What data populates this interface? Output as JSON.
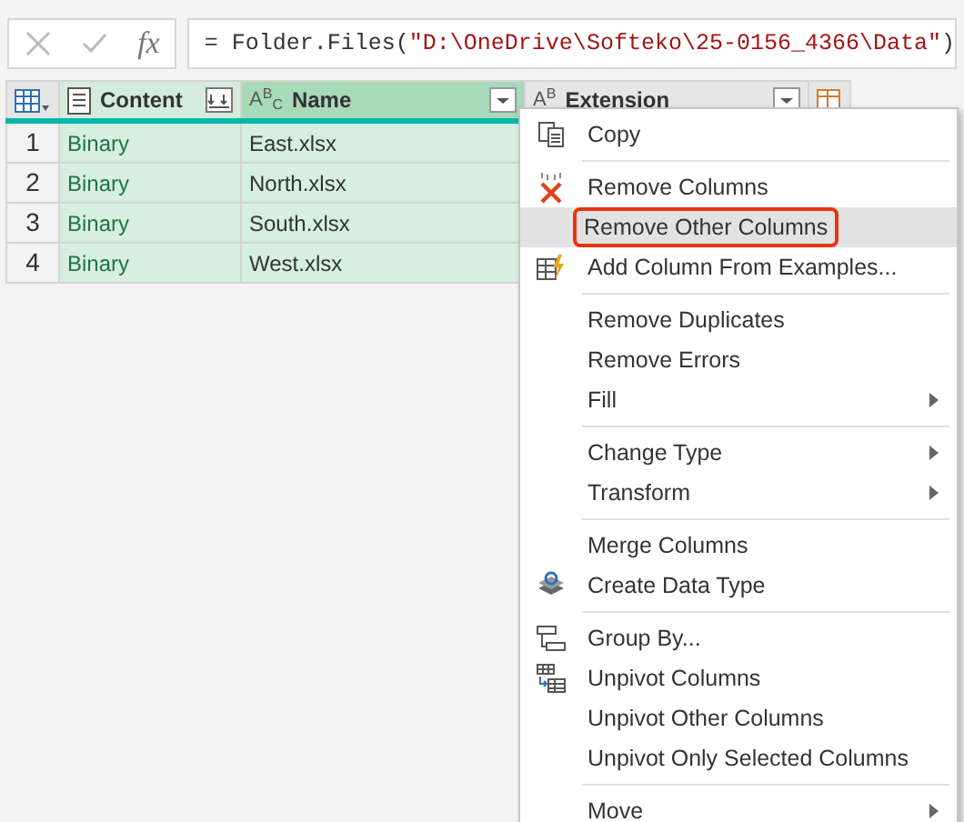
{
  "formula_bar": {
    "fx": "fx",
    "formula": "= Folder.Files(\"D:\\OneDrive\\Softeko\\25-0156_4366\\Data\")"
  },
  "table": {
    "columns": [
      {
        "label": "Content",
        "kind": "binary",
        "selected": false
      },
      {
        "label": "Name",
        "kind": "text",
        "type_glyph": "A$^{B}$$_{C}$",
        "selected": true
      },
      {
        "label": "Extension",
        "kind": "text",
        "type_glyph": "A$^{B}$",
        "selected": false
      }
    ],
    "rows": [
      {
        "number": "1",
        "cells": [
          "Binary",
          "East.xlsx"
        ]
      },
      {
        "number": "2",
        "cells": [
          "Binary",
          "North.xlsx"
        ]
      },
      {
        "number": "3",
        "cells": [
          "Binary",
          "South.xlsx"
        ]
      },
      {
        "number": "4",
        "cells": [
          "Binary",
          "West.xlsx"
        ]
      }
    ]
  },
  "context_menu": [
    {
      "kind": "item",
      "label": "Copy",
      "submenu": false,
      "highlighted": false
    },
    {
      "kind": "separator"
    },
    {
      "kind": "item",
      "label": "Remove Columns",
      "submenu": false,
      "highlighted": false
    },
    {
      "kind": "item",
      "label": "Remove Other Columns",
      "submenu": false,
      "highlighted": true
    },
    {
      "kind": "item",
      "label": "Add Column From Examples...",
      "submenu": false,
      "highlighted": false
    },
    {
      "kind": "separator"
    },
    {
      "kind": "item",
      "label": "Remove Duplicates",
      "submenu": false,
      "highlighted": false
    },
    {
      "kind": "item",
      "label": "Remove Errors",
      "submenu": false,
      "highlighted": false
    },
    {
      "kind": "item",
      "label": "Fill",
      "submenu": true,
      "highlighted": false
    },
    {
      "kind": "separator"
    },
    {
      "kind": "item",
      "label": "Change Type",
      "submenu": true,
      "highlighted": false
    },
    {
      "kind": "item",
      "label": "Transform",
      "submenu": true,
      "highlighted": false
    },
    {
      "kind": "separator"
    },
    {
      "kind": "item",
      "label": "Merge Columns",
      "submenu": false,
      "highlighted": false
    },
    {
      "kind": "item",
      "label": "Create Data Type",
      "submenu": false,
      "highlighted": false
    },
    {
      "kind": "separator"
    },
    {
      "kind": "item",
      "label": "Group By...",
      "submenu": false,
      "highlighted": false
    },
    {
      "kind": "item",
      "label": "Unpivot Columns",
      "submenu": false,
      "highlighted": false
    },
    {
      "kind": "item",
      "label": "Unpivot Other Columns",
      "submenu": false,
      "highlighted": false
    },
    {
      "kind": "item",
      "label": "Unpivot Only Selected Columns",
      "submenu": false,
      "highlighted": false
    },
    {
      "kind": "separator"
    },
    {
      "kind": "item",
      "label": "Move",
      "submenu": true,
      "highlighted": false
    }
  ]
}
